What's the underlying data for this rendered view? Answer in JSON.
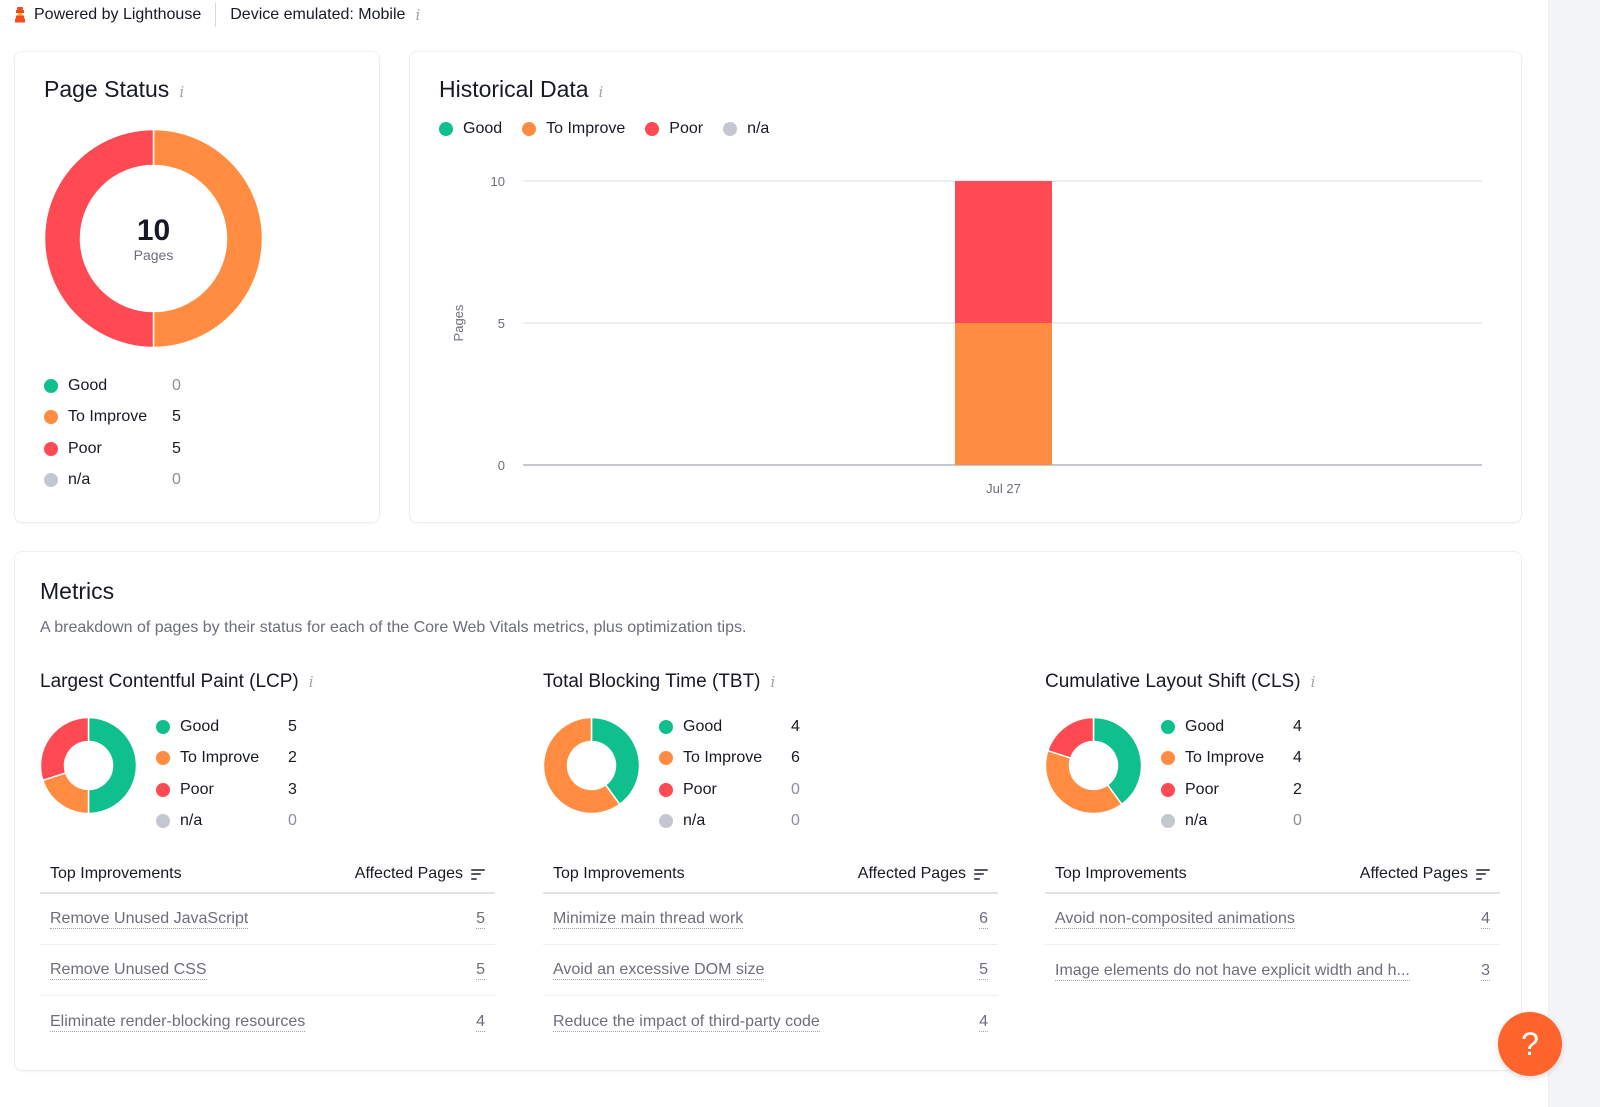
{
  "topbar": {
    "powered_by": "Powered by Lighthouse",
    "device": "Device emulated: Mobile",
    "info_glyph": "i"
  },
  "colors": {
    "good": "#0fc08e",
    "to_improve": "#ff8c40",
    "poor": "#ff4953",
    "na": "#c4c7cf",
    "help": "#ff642d"
  },
  "page_status": {
    "title": "Page Status",
    "total": "10",
    "total_label": "Pages",
    "legend": [
      {
        "key": "good",
        "label": "Good",
        "value": 0
      },
      {
        "key": "to_improve",
        "label": "To Improve",
        "value": 5
      },
      {
        "key": "poor",
        "label": "Poor",
        "value": 5
      },
      {
        "key": "na",
        "label": "n/a",
        "value": 0
      }
    ]
  },
  "historical": {
    "title": "Historical Data",
    "legend": [
      {
        "key": "good",
        "label": "Good"
      },
      {
        "key": "to_improve",
        "label": "To Improve"
      },
      {
        "key": "poor",
        "label": "Poor"
      },
      {
        "key": "na",
        "label": "n/a"
      }
    ]
  },
  "chart_data": {
    "type": "bar",
    "stacked": true,
    "title": "Historical Data",
    "xlabel": "",
    "ylabel": "Pages",
    "ylim": [
      0,
      10
    ],
    "yticks": [
      0,
      5,
      10
    ],
    "grid": true,
    "legend_position": "top-left",
    "categories": [
      "Jul 27"
    ],
    "series": [
      {
        "name": "Good",
        "key": "good",
        "values": [
          0
        ]
      },
      {
        "name": "To Improve",
        "key": "to_improve",
        "values": [
          5
        ]
      },
      {
        "name": "Poor",
        "key": "poor",
        "values": [
          5
        ]
      },
      {
        "name": "n/a",
        "key": "na",
        "values": [
          0
        ]
      }
    ]
  },
  "metrics": {
    "title": "Metrics",
    "description": "A breakdown of pages by their status for each of the Core Web Vitals metrics, plus optimization tips.",
    "table_header": {
      "left": "Top Improvements",
      "right": "Affected Pages"
    },
    "items": [
      {
        "title": "Largest Contentful Paint (LCP)",
        "legend": [
          {
            "key": "good",
            "label": "Good",
            "value": 5
          },
          {
            "key": "to_improve",
            "label": "To Improve",
            "value": 2
          },
          {
            "key": "poor",
            "label": "Poor",
            "value": 3
          },
          {
            "key": "na",
            "label": "n/a",
            "value": 0
          }
        ],
        "improvements": [
          {
            "label": "Remove Unused JavaScript",
            "count": "5"
          },
          {
            "label": "Remove Unused CSS",
            "count": "5"
          },
          {
            "label": "Eliminate render-blocking resources",
            "count": "4"
          }
        ]
      },
      {
        "title": "Total Blocking Time (TBT)",
        "legend": [
          {
            "key": "good",
            "label": "Good",
            "value": 4
          },
          {
            "key": "to_improve",
            "label": "To Improve",
            "value": 6
          },
          {
            "key": "poor",
            "label": "Poor",
            "value": 0
          },
          {
            "key": "na",
            "label": "n/a",
            "value": 0
          }
        ],
        "improvements": [
          {
            "label": "Minimize main thread work",
            "count": "6"
          },
          {
            "label": "Avoid an excessive DOM size",
            "count": "5"
          },
          {
            "label": "Reduce the impact of third-party code",
            "count": "4"
          }
        ]
      },
      {
        "title": "Cumulative Layout Shift (CLS)",
        "legend": [
          {
            "key": "good",
            "label": "Good",
            "value": 4
          },
          {
            "key": "to_improve",
            "label": "To Improve",
            "value": 4
          },
          {
            "key": "poor",
            "label": "Poor",
            "value": 2
          },
          {
            "key": "na",
            "label": "n/a",
            "value": 0
          }
        ],
        "improvements": [
          {
            "label": "Avoid non-composited animations",
            "count": "4"
          },
          {
            "label": "Image elements do not have explicit width and h...",
            "count": "3"
          }
        ]
      }
    ]
  },
  "help_button": {
    "label": "?"
  }
}
